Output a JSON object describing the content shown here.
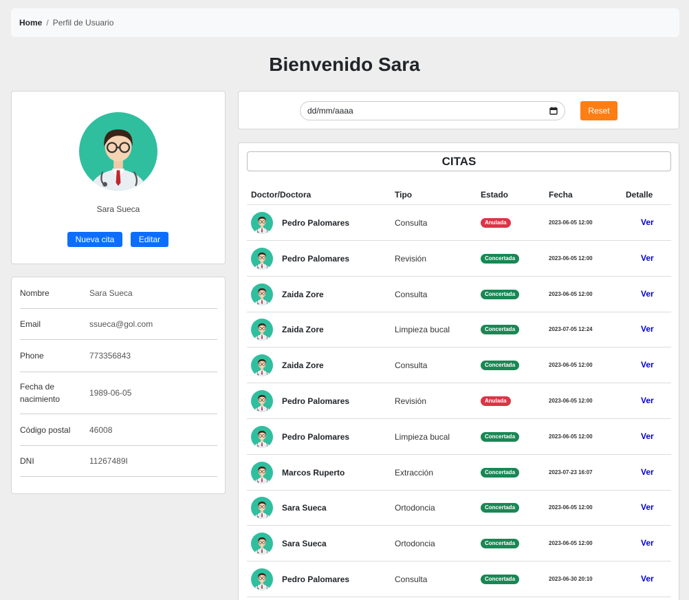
{
  "breadcrumb": {
    "home": "Home",
    "separator": "/",
    "current": "Perfil de Usuario"
  },
  "title": "Bienvenido Sara",
  "profile": {
    "name": "Sara Sueca",
    "new_button": "Nueva cita",
    "edit_button": "Editar",
    "avatar_icon": "doctor-avatar-icon"
  },
  "info": [
    {
      "label": "Nombre",
      "value": "Sara Sueca"
    },
    {
      "label": "Email",
      "value": "ssueca@gol.com"
    },
    {
      "label": "Phone",
      "value": "773356843"
    },
    {
      "label": "Fecha de nacimiento",
      "value": "1989-06-05"
    },
    {
      "label": "Código postal",
      "value": "46008"
    },
    {
      "label": "DNI",
      "value": "11267489I"
    }
  ],
  "filter": {
    "date_placeholder": "dd/mm/aaaa",
    "calendar_icon": "calendar-icon",
    "reset_button": "Reset"
  },
  "citas": {
    "title": "CITAS",
    "columns": [
      "Doctor/Doctora",
      "Tipo",
      "Estado",
      "Fecha",
      "Detalle"
    ],
    "rows": [
      {
        "doctor": "Pedro Palomares",
        "tipo": "Consulta",
        "estado": "Anulada",
        "fecha": "2023-06-05 12:00",
        "detalle": "Ver"
      },
      {
        "doctor": "Pedro Palomares",
        "tipo": "Revisión",
        "estado": "Concertada",
        "fecha": "2023-06-05 12:00",
        "detalle": "Ver"
      },
      {
        "doctor": "Zaida Zore",
        "tipo": "Consulta",
        "estado": "Concertada",
        "fecha": "2023-06-05 12:00",
        "detalle": "Ver"
      },
      {
        "doctor": "Zaida Zore",
        "tipo": "Limpieza bucal",
        "estado": "Concertada",
        "fecha": "2023-07-05 12:24",
        "detalle": "Ver"
      },
      {
        "doctor": "Zaida Zore",
        "tipo": "Consulta",
        "estado": "Concertada",
        "fecha": "2023-06-05 12:00",
        "detalle": "Ver"
      },
      {
        "doctor": "Pedro Palomares",
        "tipo": "Revisión",
        "estado": "Anulada",
        "fecha": "2023-06-05 12:00",
        "detalle": "Ver"
      },
      {
        "doctor": "Pedro Palomares",
        "tipo": "Limpieza bucal",
        "estado": "Concertada",
        "fecha": "2023-06-05 12:00",
        "detalle": "Ver"
      },
      {
        "doctor": "Marcos Ruperto",
        "tipo": "Extracción",
        "estado": "Concertada",
        "fecha": "2023-07-23 16:07",
        "detalle": "Ver"
      },
      {
        "doctor": "Sara Sueca",
        "tipo": "Ortodoncia",
        "estado": "Concertada",
        "fecha": "2023-06-05 12:00",
        "detalle": "Ver"
      },
      {
        "doctor": "Sara Sueca",
        "tipo": "Ortodoncia",
        "estado": "Concertada",
        "fecha": "2023-06-05 12:00",
        "detalle": "Ver"
      },
      {
        "doctor": "Pedro Palomares",
        "tipo": "Consulta",
        "estado": "Concertada",
        "fecha": "2023-06-30 20:10",
        "detalle": "Ver"
      }
    ]
  },
  "colors": {
    "primary": "#0d6efd",
    "reset": "#fd7e14",
    "anulada": "#dc3545",
    "concertada": "#198754",
    "link": "#0000cc",
    "avatar_bg": "#2fbf9f"
  }
}
